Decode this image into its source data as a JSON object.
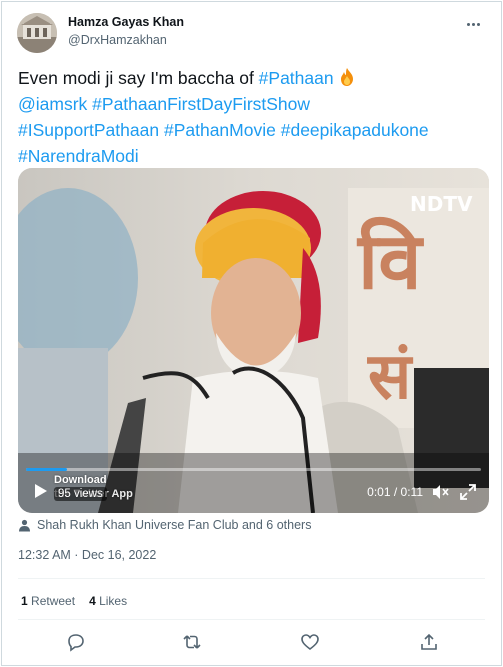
{
  "author": {
    "name": "Hamza Gayas Khan",
    "handle": "@DrxHamzakhan"
  },
  "tweet": {
    "text_part1": "Even modi ji say I'm baccha of ",
    "tags": [
      "#Pathaan",
      "@iamsrk",
      "#PathaanFirstDayFirstShow",
      "#ISupportPathaan",
      "#PathanMovie",
      "#deepikapadukone",
      "#NarendraModi"
    ]
  },
  "video": {
    "watermark": "NDTV",
    "download_label_line1": "Download",
    "download_label_line2": "the Twitter App",
    "views": "95 views",
    "time": "0:01 / 0:11",
    "progress": 0.09
  },
  "tagged_people": "Shah Rukh Khan Universe Fan Club and 6 others",
  "timestamp": "12:32 AM · Dec 16, 2022",
  "stats": {
    "retweets_count": "1",
    "retweets_label": "Retweet",
    "likes_count": "4",
    "likes_label": "Likes"
  },
  "colors": {
    "link": "#1d9bf0",
    "secondary": "#536471"
  },
  "icons": [
    "more-icon",
    "fire-emoji-icon",
    "play-icon",
    "volume-icon",
    "fullscreen-icon",
    "person-tag-icon",
    "reply-icon",
    "retweet-icon",
    "like-icon",
    "share-icon"
  ]
}
